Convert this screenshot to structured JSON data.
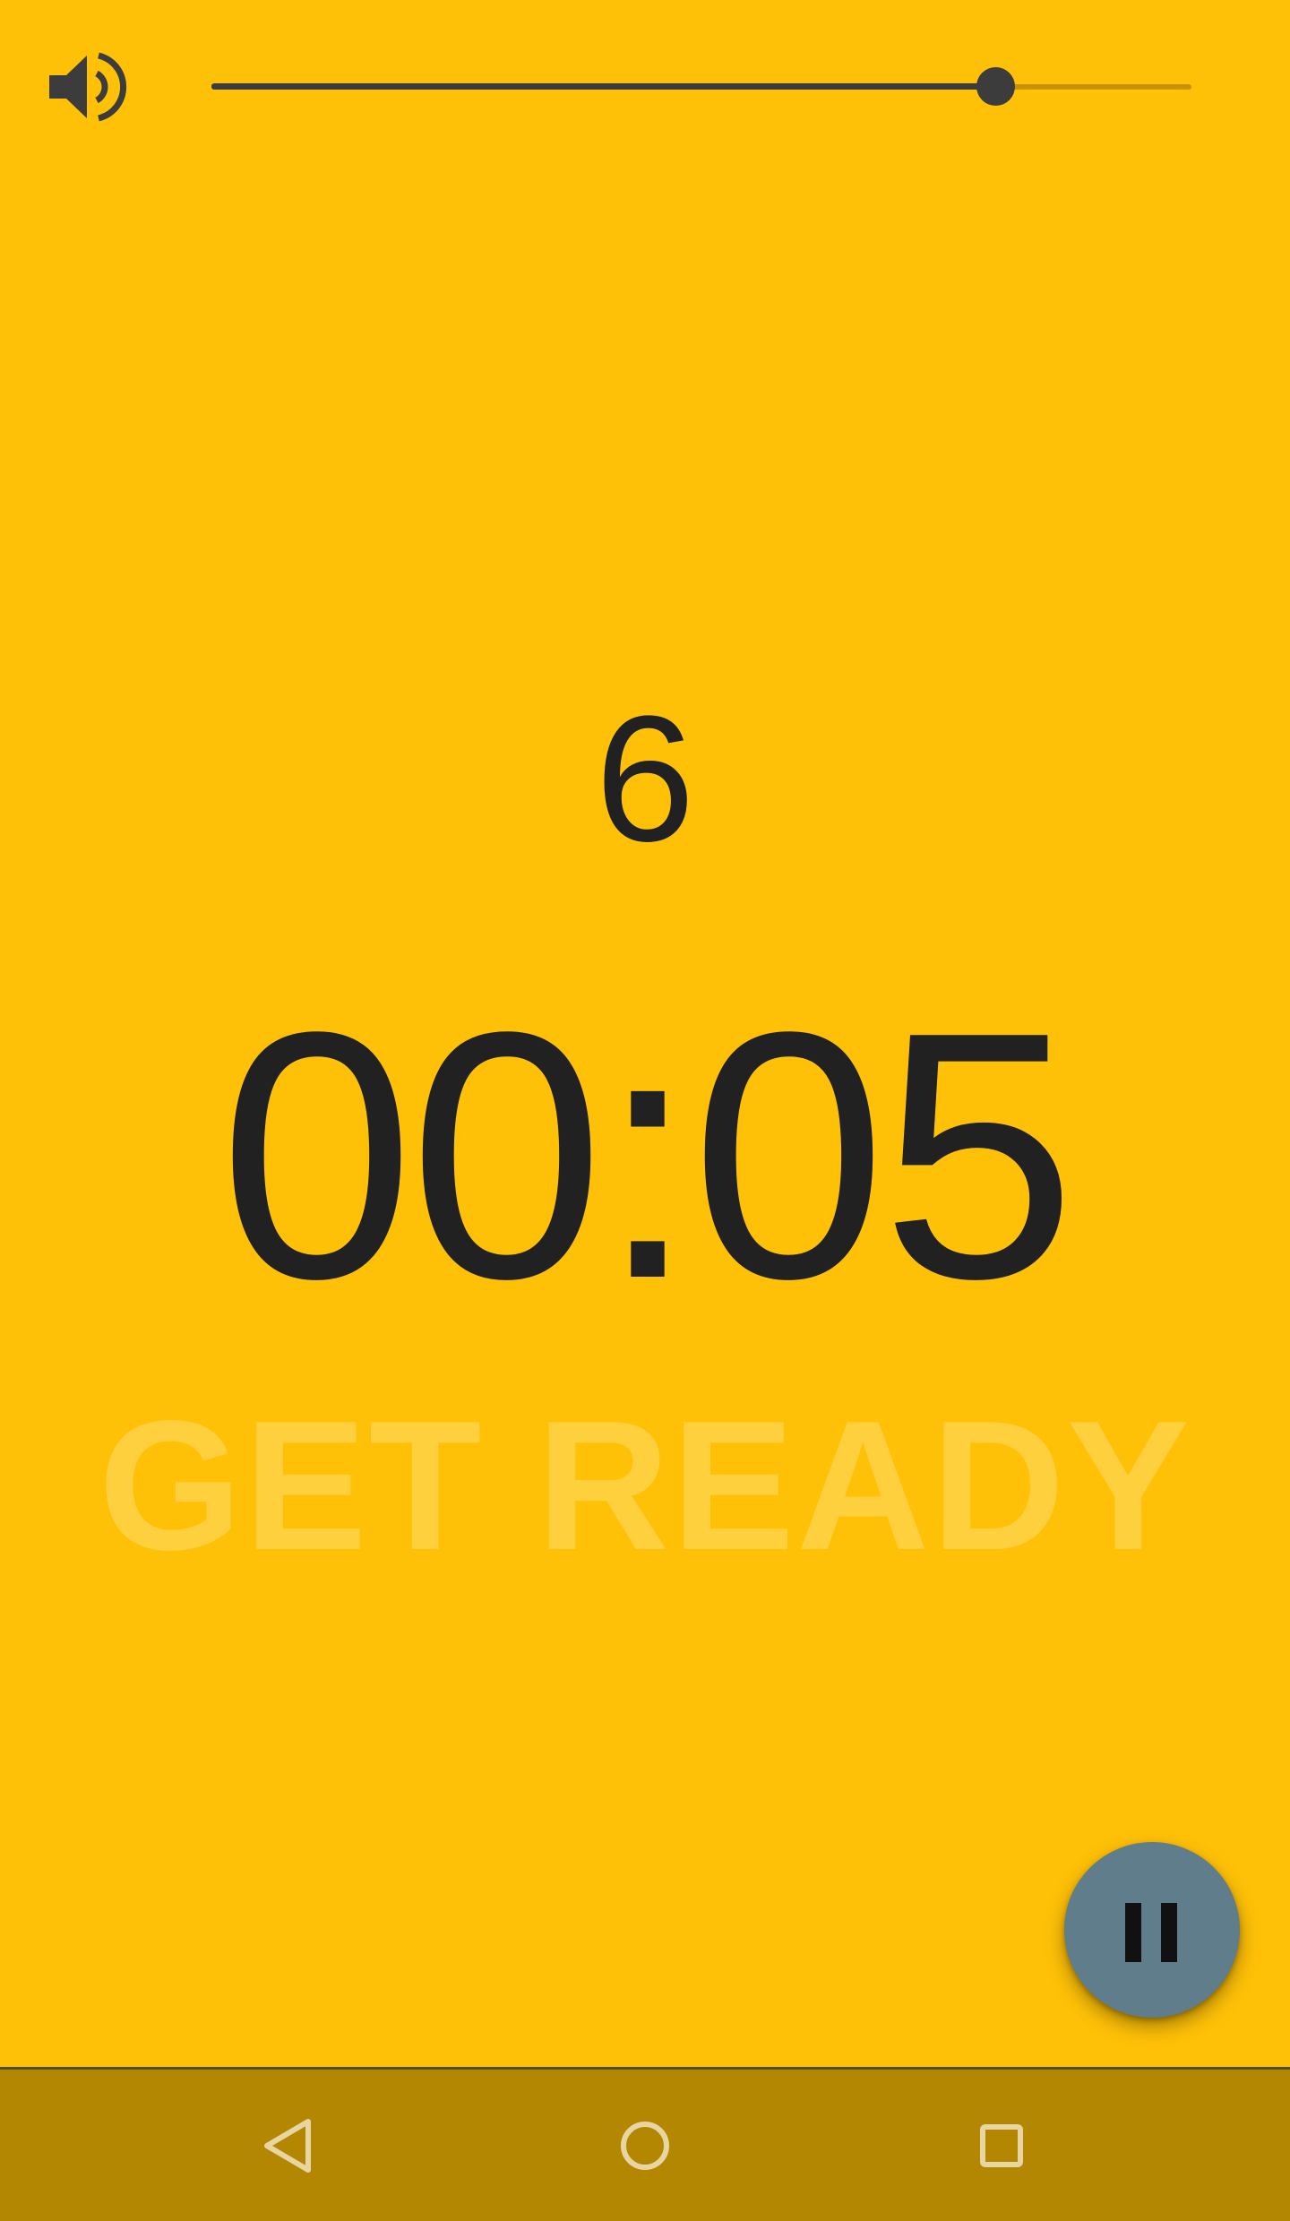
{
  "colors": {
    "background": "#FFC107",
    "text": "#212121",
    "faded_label": "#FFD54F",
    "fab": "#607D8B",
    "nav_bar": "#B38702",
    "slider_active": "#3C3C3C",
    "slider_inactive": "#C79300"
  },
  "icons": {
    "volume": "volume-up-icon",
    "pause": "pause-icon",
    "back": "back-triangle-icon",
    "home": "home-circle-icon",
    "recents": "recents-square-icon"
  },
  "volume": {
    "level": 0.8
  },
  "counter": {
    "value": "6"
  },
  "timer": {
    "display": "00:05"
  },
  "phase": {
    "label": "GET READY"
  }
}
